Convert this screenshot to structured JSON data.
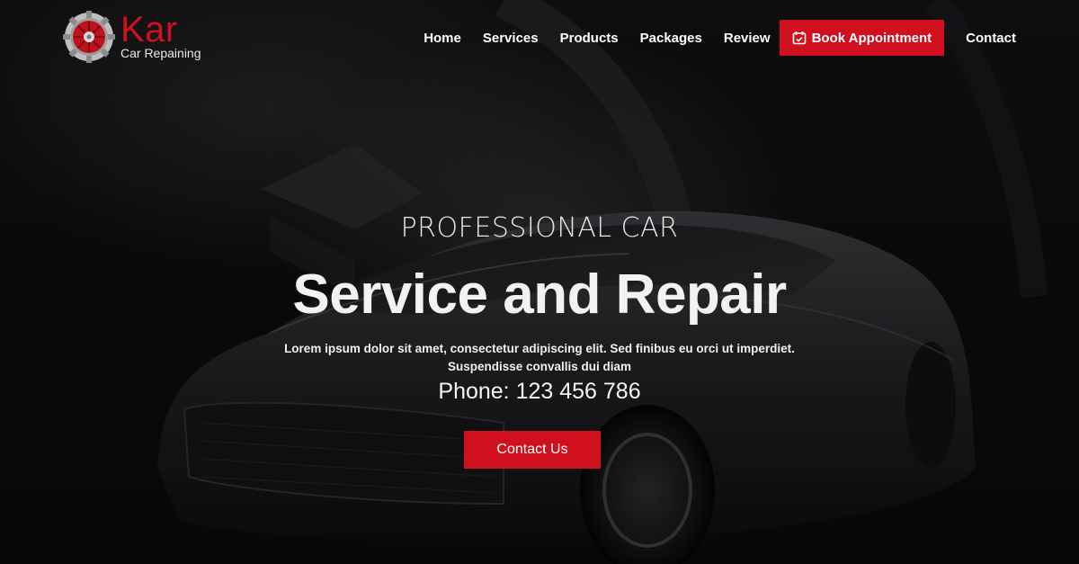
{
  "brand": {
    "name": "Kar",
    "tagline": "Car Repaining"
  },
  "nav": {
    "items": [
      "Home",
      "Services",
      "Products",
      "Packages",
      "Review"
    ],
    "book_label": "Book Appointment",
    "book_icon": "calendar-check-icon",
    "contact_label": "Contact"
  },
  "hero": {
    "kicker": "PROFESSIONAL CAR",
    "headline": "Service and Repair",
    "description_line1": "Lorem ipsum dolor sit amet, consectetur adipiscing elit. Sed finibus eu orci ut imperdiet.",
    "description_line2": "Suspendisse convallis dui diam",
    "phone": "Phone: 123 456 786",
    "cta_label": "Contact Us"
  },
  "colors": {
    "accent": "#d0101e",
    "background": "#0b0b0c",
    "text": "#ffffff"
  }
}
